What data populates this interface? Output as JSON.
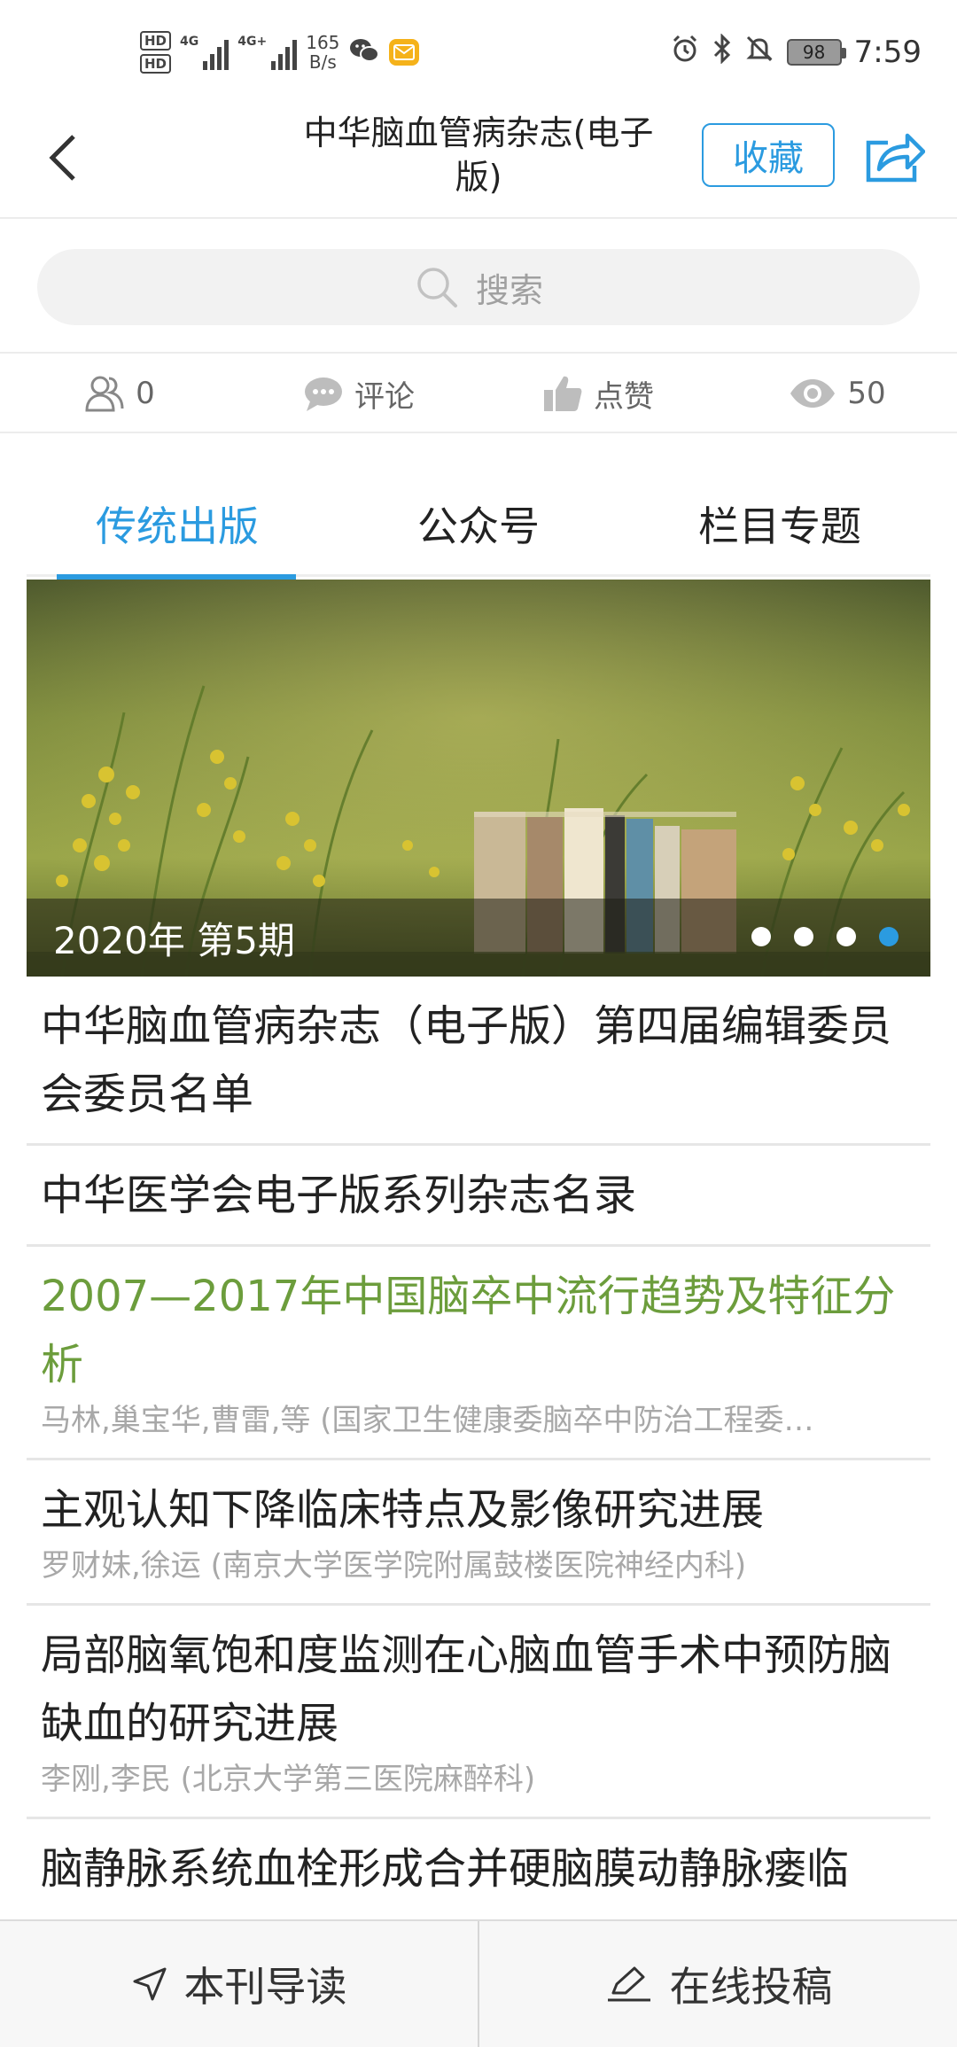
{
  "status_bar": {
    "hd1": "HD",
    "hd2": "HD",
    "sim1_gen": "4G",
    "sim2_gen": "4G+",
    "net_speed_value": "165",
    "net_speed_unit": "B/s",
    "battery": "98",
    "time": "7:59"
  },
  "header": {
    "title": "中华脑血管病杂志(电子版)",
    "favorite_label": "收藏"
  },
  "search": {
    "placeholder": "搜索"
  },
  "stats": {
    "followers": "0",
    "comment_label": "评论",
    "like_label": "点赞",
    "views": "50"
  },
  "tabs": [
    {
      "label": "传统出版",
      "active": true
    },
    {
      "label": "公众号",
      "active": false
    },
    {
      "label": "栏目专题",
      "active": false
    }
  ],
  "banner": {
    "caption": "2020年 第5期",
    "slide_count": 4,
    "active_slide": 4
  },
  "articles": [
    {
      "title": "中华脑血管病杂志（电子版）第四届编辑委员会委员名单",
      "authors": ""
    },
    {
      "title": "中华医学会电子版系列杂志名录",
      "authors": ""
    },
    {
      "title": "2007—2017年中国脑卒中流行趋势及特征分析",
      "authors": "马林,巢宝华,曹雷,等 (国家卫生健康委脑卒中防治工程委…",
      "highlight": true
    },
    {
      "title": "主观认知下降临床特点及影像研究进展",
      "authors": "罗财妹,徐运 (南京大学医学院附属鼓楼医院神经内科)"
    },
    {
      "title": "局部脑氧饱和度监测在心脑血管手术中预防脑缺血的研究进展",
      "authors": "李刚,李民 (北京大学第三医院麻醉科)"
    },
    {
      "title": "脑静脉系统血栓形成合并硬脑膜动静脉瘘临",
      "authors": ""
    }
  ],
  "bottom_bar": {
    "guide_label": "本刊导读",
    "submit_label": "在线投稿"
  },
  "colors": {
    "accent": "#2b9be0",
    "highlight_title": "#6c9d3c"
  }
}
